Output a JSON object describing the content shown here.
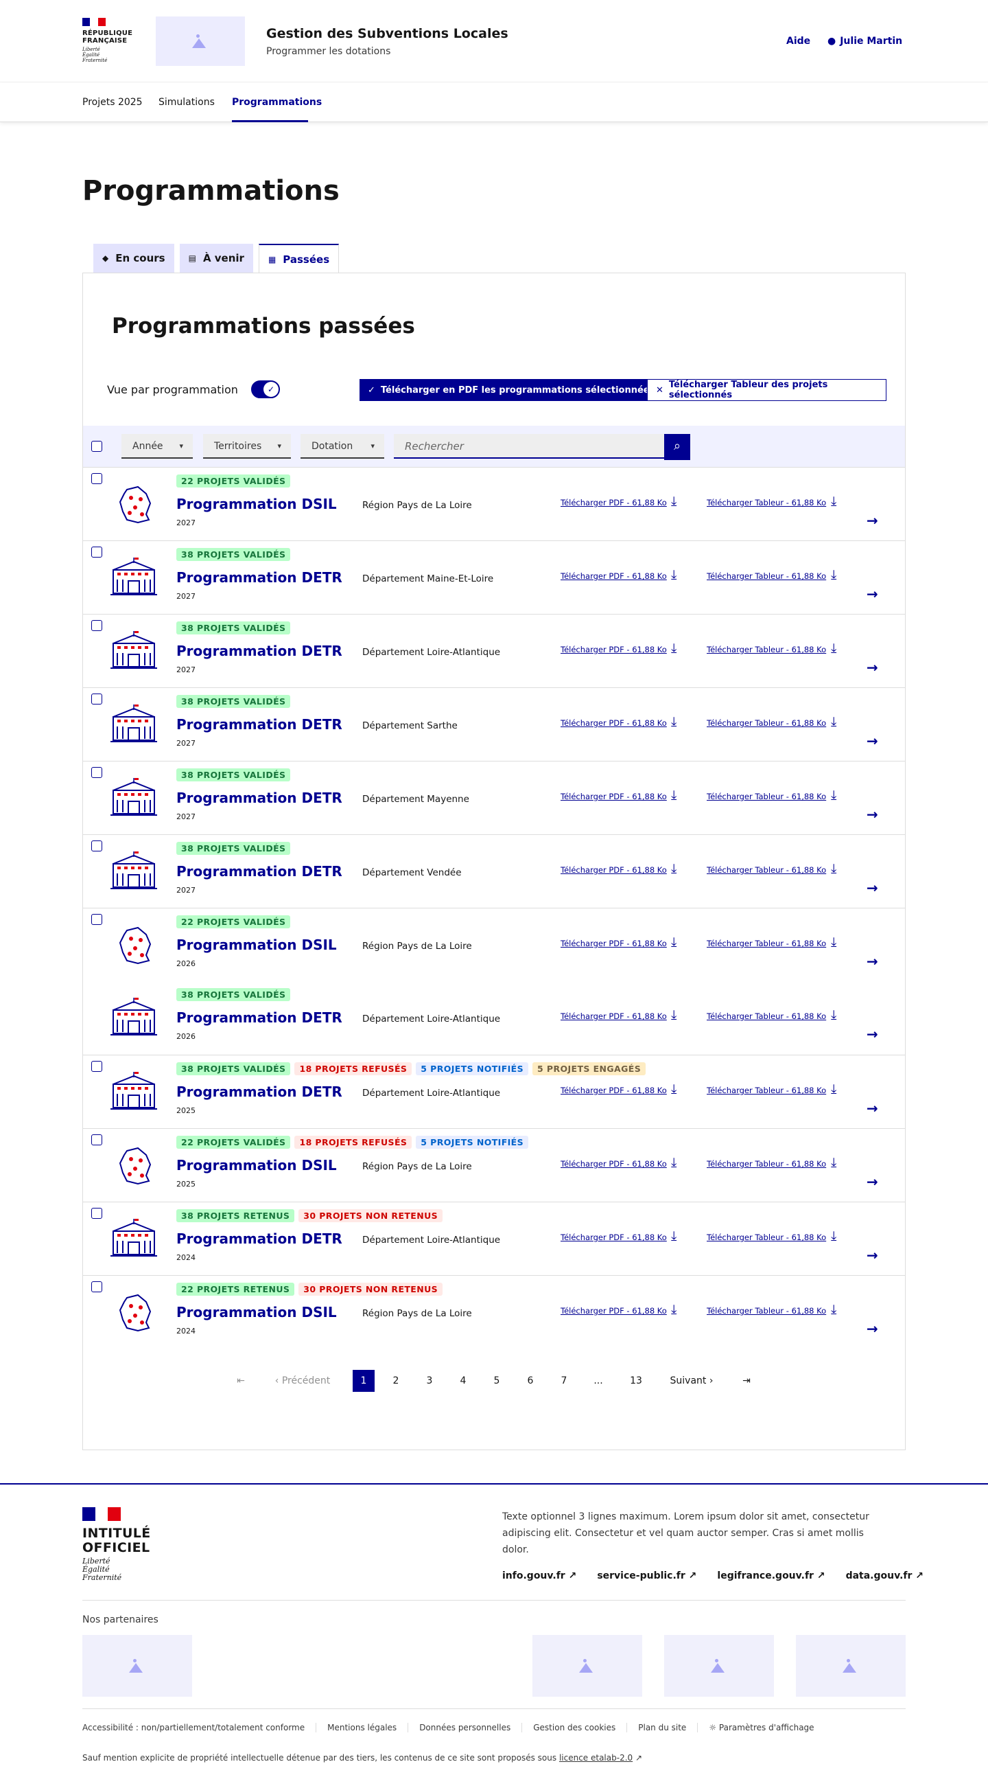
{
  "header": {
    "republique": [
      "RÉPUBLIQUE",
      "FRANÇAISE"
    ],
    "motto": [
      "Liberté",
      "Égalité",
      "Fraternité"
    ],
    "site_title": "Gestion des Subventions Locales",
    "site_subtitle": "Programmer les dotations",
    "help_link": "Aide",
    "user_name": "Julie Martin"
  },
  "nav": {
    "items": [
      "Projets 2025",
      "Simulations",
      "Programmations"
    ],
    "active": "Programmations"
  },
  "page_title": "Programmations",
  "tabs": {
    "current": "En cours",
    "upcoming": "À venir",
    "past": "Passées"
  },
  "section_title": "Programmations passées",
  "toolbar": {
    "toggle_label": "Vue par programmation",
    "pdf_button": "Télécharger en PDF les programmations sélectionnées",
    "sheet_button": "Télécharger Tableur des projets sélectionnés"
  },
  "filters": {
    "year": "Année",
    "territories": "Territoires",
    "dotation": "Dotation",
    "search_placeholder": "Rechercher"
  },
  "download_pdf_label": "Télécharger PDF - 61,88 Ko",
  "download_sheet_label": "Télécharger Tableur - 61,88 Ko",
  "rows": [
    {
      "badges": [
        {
          "text": "22 projets validés",
          "kind": "green"
        }
      ],
      "title": "Programmation DSIL",
      "year": "2027",
      "territory": "Région Pays de La Loire",
      "illustration": "france-map",
      "checkbox": true
    },
    {
      "badges": [
        {
          "text": "38 projets validés",
          "kind": "green"
        }
      ],
      "title": "Programmation DETR",
      "year": "2027",
      "territory": "Département Maine-Et-Loire",
      "illustration": "city-hall",
      "checkbox": true
    },
    {
      "badges": [
        {
          "text": "38 projets validés",
          "kind": "green"
        }
      ],
      "title": "Programmation DETR",
      "year": "2027",
      "territory": "Département Loire-Atlantique",
      "illustration": "city-hall",
      "checkbox": true
    },
    {
      "badges": [
        {
          "text": "38 projets validés",
          "kind": "green"
        }
      ],
      "title": "Programmation DETR",
      "year": "2027",
      "territory": "Département Sarthe",
      "illustration": "city-hall",
      "checkbox": true
    },
    {
      "badges": [
        {
          "text": "38 projets validés",
          "kind": "green"
        }
      ],
      "title": "Programmation DETR",
      "year": "2027",
      "territory": "Département Mayenne",
      "illustration": "city-hall",
      "checkbox": true
    },
    {
      "badges": [
        {
          "text": "38 projets validés",
          "kind": "green"
        }
      ],
      "title": "Programmation DETR",
      "year": "2027",
      "territory": "Département Vendée",
      "illustration": "city-hall",
      "checkbox": true
    },
    {
      "badges": [
        {
          "text": "22 projets validés",
          "kind": "green"
        }
      ],
      "title": "Programmation DSIL",
      "year": "2026",
      "territory": "Région Pays de La Loire",
      "illustration": "france-map",
      "checkbox": true
    },
    {
      "badges": [
        {
          "text": "38 projets validés",
          "kind": "green"
        }
      ],
      "title": "Programmation DETR",
      "year": "2026",
      "territory": "Département Loire-Atlantique",
      "illustration": "city-hall",
      "checkbox": false
    },
    {
      "badges": [
        {
          "text": "38 projets validés",
          "kind": "green"
        },
        {
          "text": "18 projets refusés",
          "kind": "red"
        },
        {
          "text": "5 projets notifiés",
          "kind": "blue"
        },
        {
          "text": "5 projets engagés",
          "kind": "yellow"
        }
      ],
      "title": "Programmation DETR",
      "year": "2025",
      "territory": "Département Loire-Atlantique",
      "illustration": "city-hall",
      "checkbox": true
    },
    {
      "badges": [
        {
          "text": "22 projets validés",
          "kind": "green"
        },
        {
          "text": "18 projets refusés",
          "kind": "red"
        },
        {
          "text": "5 projets notifiés",
          "kind": "blue"
        }
      ],
      "title": "Programmation DSIL",
      "year": "2025",
      "territory": "Région Pays de La Loire",
      "illustration": "france-map",
      "checkbox": true
    },
    {
      "badges": [
        {
          "text": "38 projets retenus",
          "kind": "green"
        },
        {
          "text": "30 projets non retenus",
          "kind": "red"
        }
      ],
      "title": "Programmation DETR",
      "year": "2024",
      "territory": "Département Loire-Atlantique",
      "illustration": "city-hall",
      "checkbox": true
    },
    {
      "badges": [
        {
          "text": "22 projets retenus",
          "kind": "green"
        },
        {
          "text": "30 projets non retenus",
          "kind": "red"
        }
      ],
      "title": "Programmation DSIL",
      "year": "2024",
      "territory": "Région Pays de La Loire",
      "illustration": "france-map",
      "checkbox": true
    }
  ],
  "pagination": {
    "previous": "Précédent",
    "next": "Suivant",
    "pages": [
      "1",
      "2",
      "3",
      "4",
      "5",
      "6",
      "7",
      "...",
      "13"
    ],
    "current": "1"
  },
  "footer": {
    "org_name": [
      "INTITULÉ",
      "OFFICIEL"
    ],
    "motto": [
      "Liberté",
      "Égalité",
      "Fraternité"
    ],
    "description": "Texte optionnel 3 lignes maximum. Lorem ipsum dolor sit amet, consectetur adipiscing elit. Consectetur et vel quam auctor semper. Cras si amet mollis dolor.",
    "links": [
      "info.gouv.fr",
      "service-public.fr",
      "legifrance.gouv.fr",
      "data.gouv.fr"
    ],
    "partners_title": "Nos partenaires",
    "bottom_links": [
      "Accessibilité : non/partiellement/totalement conforme",
      "Mentions légales",
      "Données personnelles",
      "Gestion des cookies",
      "Plan du site",
      "Paramètres d'affichage"
    ],
    "legal_text": "Sauf mention explicite de propriété intellectuelle détenue par des tiers, les contenus de ce site sont proposés sous",
    "legal_link": "licence etalab-2.0"
  },
  "colors": {
    "primary": "#000091",
    "flag_blue": "#000091",
    "flag_red": "#e1000f",
    "success_bg": "#b8fec9",
    "error_bg": "#ffe9e6",
    "info_bg": "#e8edff",
    "warning_bg": "#feecc2"
  }
}
